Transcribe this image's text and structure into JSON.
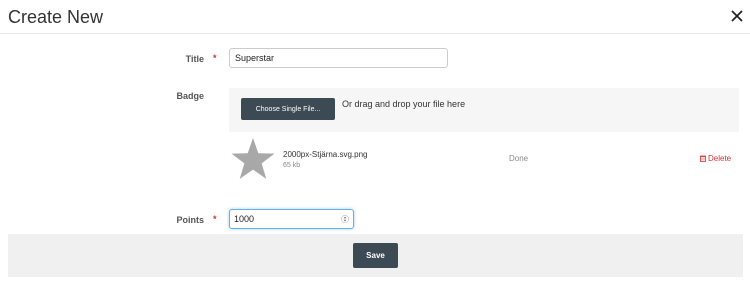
{
  "modal": {
    "title": "Create New",
    "close_icon": "close-icon"
  },
  "form": {
    "title_label": "Title",
    "title_required": "*",
    "title_value": "Superstar",
    "badge_label": "Badge",
    "choose_button": "Choose Single File...",
    "drop_hint": "Or drag and drop your file here",
    "file": {
      "thumbnail_icon": "star-icon",
      "name": "2000px-Stjärna.svg.png",
      "size": "65 kb",
      "status": "Done",
      "delete_label": "Delete",
      "delete_icon": "trash-icon"
    },
    "points_label": "Points",
    "points_required": "*",
    "points_value": "1000"
  },
  "footer": {
    "save_label": "Save"
  },
  "colors": {
    "primary_button": "#3c4a53",
    "required_mark": "#d0312d",
    "focus_border": "#66afe9",
    "dropzone_bg": "#f6f6f6",
    "footer_bg": "#f0f0f0"
  }
}
